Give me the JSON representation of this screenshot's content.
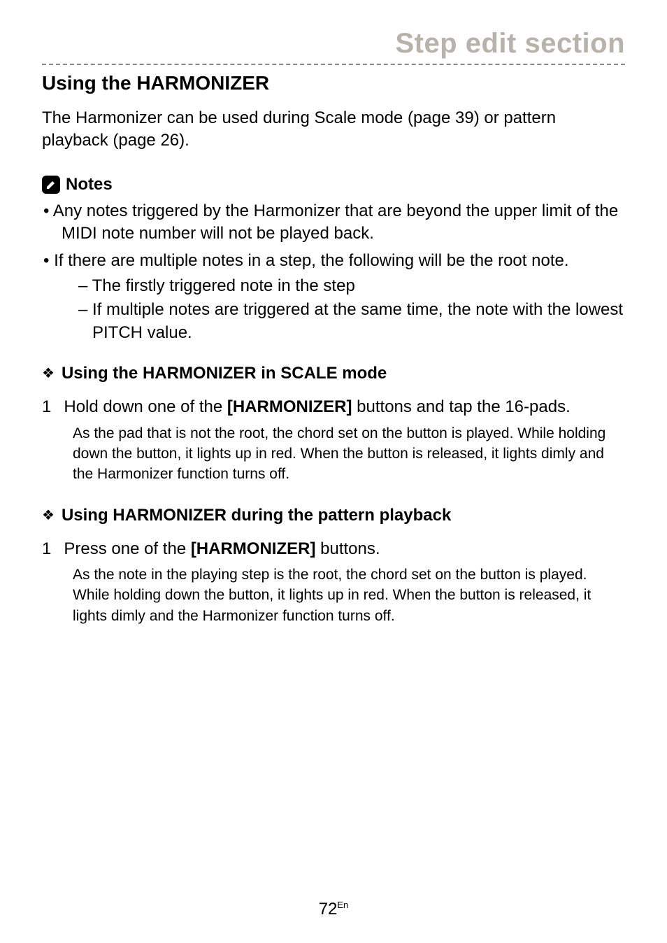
{
  "header": {
    "title": "Step edit section"
  },
  "heading": "Using the HARMONIZER",
  "intro": "The Harmonizer can be used during Scale mode (page 39) or pattern playback (page 26).",
  "notes_label": "Notes",
  "notes": [
    {
      "text": "Any notes triggered by the Harmonizer that are beyond the upper limit of the MIDI note number will not be played back."
    },
    {
      "text": "If there are multiple notes in a step, the following will be the root note.",
      "sub": [
        "The firstly triggered note in the step",
        "If multiple notes are triggered at the same time, the note with the lowest PITCH value."
      ]
    }
  ],
  "section1": {
    "heading": "Using the HARMONIZER in SCALE mode",
    "step_num": "1",
    "step_pre": "Hold down one of the ",
    "step_bold": "[HARMONIZER]",
    "step_post": " buttons and tap the 16-pads.",
    "body": "As the pad that is not the root, the chord set on the button is played. While holding down the button, it lights up in red. When the button is released, it lights dimly and the Harmonizer function turns off."
  },
  "section2": {
    "heading": "Using HARMONIZER during the pattern playback",
    "step_num": "1",
    "step_pre": "Press one of the ",
    "step_bold": "[HARMONIZER]",
    "step_post": " buttons.",
    "body": "As the note in the playing step is the root, the chord set on the button is played. While holding down the button, it lights up in red. When the button is released, it lights dimly and the Harmonizer function turns off."
  },
  "footer": {
    "page": "72",
    "lang": "En"
  }
}
